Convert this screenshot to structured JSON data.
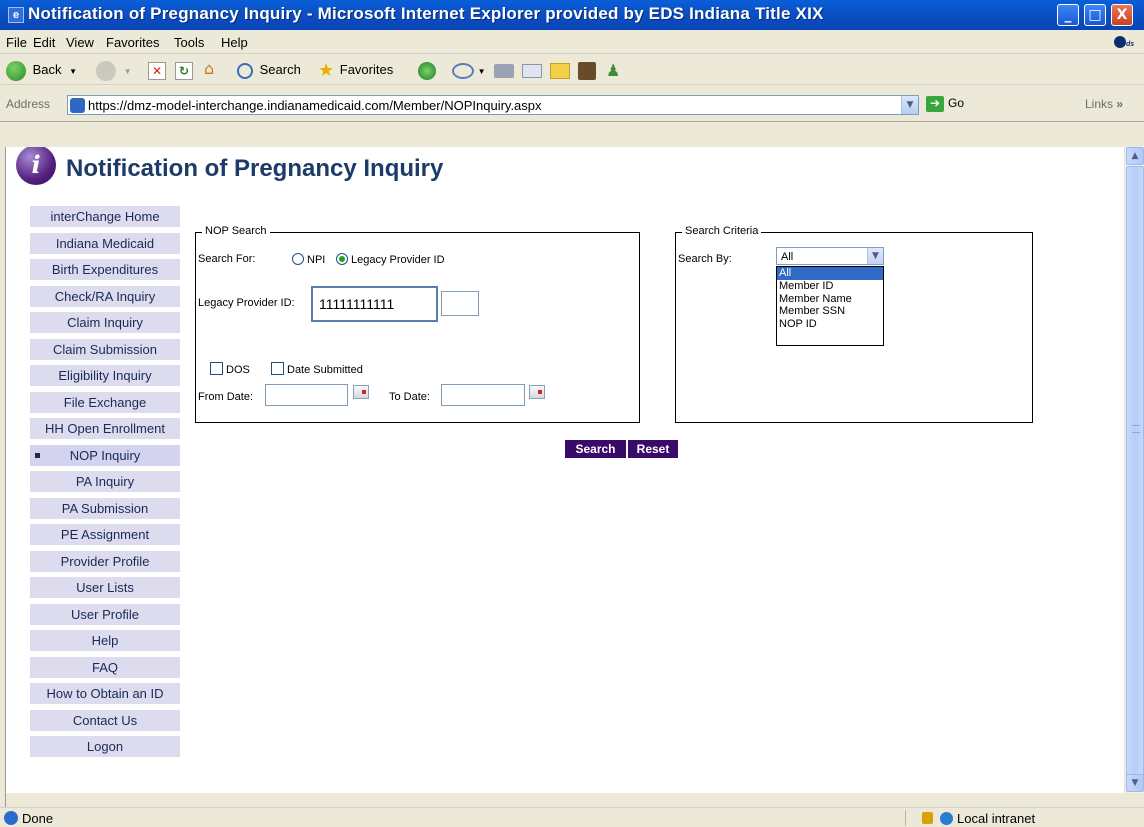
{
  "window": {
    "title": "Notification of Pregnancy Inquiry - Microsoft Internet Explorer provided by EDS Indiana Title XIX",
    "minimize": "_",
    "maximize": "□",
    "close": "X"
  },
  "menu": [
    "File",
    "Edit",
    "View",
    "Favorites",
    "Tools",
    "Help"
  ],
  "toolbar": {
    "back": "Back",
    "search": "Search",
    "favorites": "Favorites"
  },
  "address": {
    "label": "Address",
    "url": "https://dmz-model-interchange.indianamedicaid.com/Member/NOPInquiry.aspx",
    "go": "Go",
    "links": "Links"
  },
  "page": {
    "title": "Notification of Pregnancy Inquiry",
    "logo_letter": "i"
  },
  "nav": [
    {
      "label": "interChange Home"
    },
    {
      "label": "Indiana Medicaid"
    },
    {
      "label": "Birth Expenditures"
    },
    {
      "label": "Check/RA Inquiry"
    },
    {
      "label": "Claim Inquiry"
    },
    {
      "label": "Claim Submission"
    },
    {
      "label": "Eligibility Inquiry"
    },
    {
      "label": "File Exchange"
    },
    {
      "label": "HH Open Enrollment"
    },
    {
      "label": "NOP Inquiry",
      "active": true
    },
    {
      "label": "PA Inquiry"
    },
    {
      "label": "PA Submission"
    },
    {
      "label": "PE Assignment"
    },
    {
      "label": "Provider Profile"
    },
    {
      "label": "User Lists"
    },
    {
      "label": "User Profile"
    },
    {
      "label": "Help"
    },
    {
      "label": "FAQ"
    },
    {
      "label": "How to Obtain an ID"
    },
    {
      "label": "Contact Us"
    },
    {
      "label": "Logon"
    }
  ],
  "nop_search": {
    "legend": "NOP Search",
    "search_for_label": "Search For:",
    "npi_label": "NPI",
    "legacy_label": "Legacy Provider ID",
    "selected": "legacy",
    "legacy_id_label": "Legacy Provider ID:",
    "legacy_id_value": "11111111111",
    "suffix_value": "",
    "dos_label": "DOS",
    "date_submitted_label": "Date Submitted",
    "from_date_label": "From Date:",
    "to_date_label": "To Date:",
    "from_date_value": "",
    "to_date_value": ""
  },
  "search_criteria": {
    "legend": "Search Criteria",
    "search_by_label": "Search By:",
    "selected": "All",
    "options": [
      "All",
      "Member ID",
      "Member Name",
      "Member SSN",
      "NOP ID"
    ]
  },
  "buttons": {
    "search": "Search",
    "reset": "Reset"
  },
  "status": {
    "text": "Done",
    "zone": "Local intranet"
  },
  "colors": {
    "title_blue": "#1d3a68",
    "nav_bg": "#dcdcee",
    "button_purple": "#3a0a6b",
    "selection_blue": "#316ac5"
  }
}
